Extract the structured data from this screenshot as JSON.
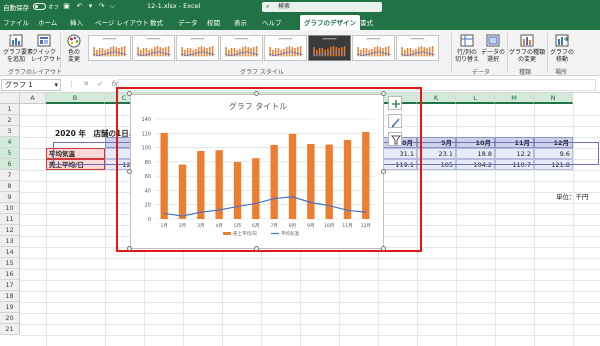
{
  "titlebar": {
    "autosave": "自動保存",
    "autosave_state": "オフ",
    "filename": "12-1.xlsx  -  Excel",
    "search_placeholder": "検索"
  },
  "tabs": [
    "ファイル",
    "ホーム",
    "挿入",
    "ページ レイアウト",
    "数式",
    "データ",
    "校閲",
    "表示",
    "ヘルプ",
    "グラフのデザイン",
    "書式"
  ],
  "ribbon": {
    "add_element": "グラフ要素\nを追加",
    "quick_layout": "クイック\nレイアウト",
    "change_color": "色の\n変更",
    "group_layout": "グラフのレイアウト",
    "group_style": "グラフ スタイル",
    "switch_rowcol": "行/列の\n切り替え",
    "select_data": "データの\n選択",
    "group_data": "データ",
    "change_type": "グラフの種類\nの変更",
    "group_type": "種類",
    "move_chart": "グラフの\n移動",
    "group_location": "場所"
  },
  "formula": {
    "namebox": "グラフ 1",
    "fx": "fx"
  },
  "columns": [
    "A",
    "B",
    "C",
    "D",
    "E",
    "F",
    "G",
    "H",
    "I",
    "J",
    "K",
    "L",
    "M",
    "N"
  ],
  "rows": [
    "1",
    "2",
    "3",
    "4",
    "5",
    "6",
    "7",
    "8",
    "9",
    "10",
    "11",
    "12",
    "13",
    "14",
    "15",
    "16",
    "17",
    "18",
    "19",
    "20",
    "21"
  ],
  "sheet": {
    "title": "2020 年　店舗の1日あたりの平均売上と月々の平均気温",
    "months": [
      "1月",
      "2月",
      "3月",
      "4月",
      "5月",
      "6月",
      "7月",
      "8月",
      "9月",
      "10月",
      "11月",
      "12月"
    ],
    "row5_label": "平均気温",
    "row5": [
      "7.8",
      "4.2",
      "9.5",
      "12.6",
      "17.4",
      "21.8",
      "28.6",
      "31.1",
      "23.1",
      "18.8",
      "12.2",
      "9.6"
    ],
    "row6_label": "売上平均/日",
    "row6": [
      "120.5",
      "76.2",
      "95.2",
      "96.3",
      "80",
      "85.2",
      "103.6",
      "119.1",
      "105",
      "104.2",
      "110.7",
      "121.8"
    ],
    "unit_note": "単位：千円"
  },
  "chart_data": {
    "type": "bar",
    "title": "グラフ タイトル",
    "categories": [
      "1月",
      "2月",
      "3月",
      "4月",
      "5月",
      "6月",
      "7月",
      "8月",
      "9月",
      "10月",
      "11月",
      "12月"
    ],
    "series": [
      {
        "name": "売上平均/日",
        "type": "bar",
        "color": "#ed7d31",
        "values": [
          120.5,
          76.2,
          95.2,
          96.3,
          80,
          85.2,
          103.6,
          119.1,
          105,
          104.2,
          110.7,
          121.8
        ]
      },
      {
        "name": "平均気温",
        "type": "line",
        "color": "#4472c4",
        "values": [
          7.8,
          4.2,
          9.5,
          12.6,
          17.4,
          21.8,
          28.6,
          31.1,
          23.1,
          18.8,
          12.2,
          9.6
        ]
      }
    ],
    "ylim": [
      0,
      140
    ],
    "yticks": [
      "0",
      "20",
      "40",
      "60",
      "80",
      "100",
      "120",
      "140"
    ],
    "grid": true,
    "legend": "bottom"
  },
  "colors": {
    "excel_green": "#217346",
    "selection_red": "#e01818"
  }
}
